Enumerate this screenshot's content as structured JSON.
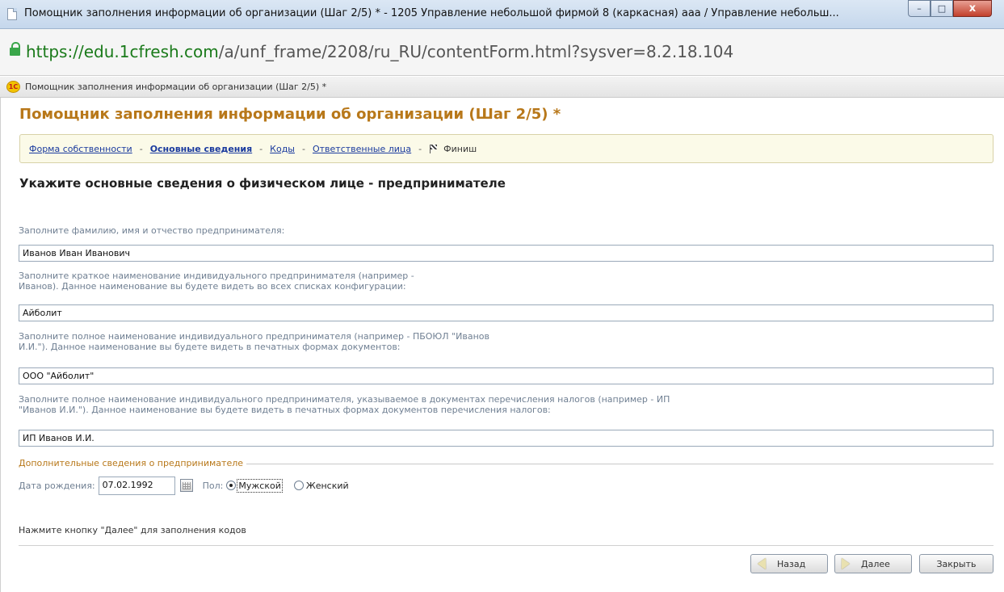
{
  "window": {
    "title": "Помощник заполнения информации об организации (Шаг 2/5) * - 1205 Управление небольшой фирмой 8 (каркасная) ааа / Управление небольш...",
    "min_glyph": "–",
    "max_glyph": "□",
    "close_glyph": "x"
  },
  "address": {
    "prefix": "https://",
    "host": "edu.1cfresh.com",
    "path": "/a/unf_frame/2208/ru_RU/contentForm.html?sysver=8.2.18.104"
  },
  "tab": {
    "logo_text": "1С",
    "title": "Помощник заполнения информации об организации (Шаг 2/5) *"
  },
  "form": {
    "title": "Помощник заполнения информации об организации (Шаг 2/5) *",
    "steps": [
      {
        "label": "Форма собственности"
      },
      {
        "label": "Основные сведения"
      },
      {
        "label": "Коды"
      },
      {
        "label": "Ответственные лица"
      },
      {
        "label": "Финиш"
      }
    ],
    "step_separator": "-",
    "section_title": "Укажите основные сведения о физическом лице - предпринимателе",
    "fields": [
      {
        "label_lines": [
          "Заполните фамилию, имя и отчество предпринимателя:"
        ],
        "value": "Иванов Иван Иванович"
      },
      {
        "label_lines": [
          "Заполните краткое наименование индивидуального предпринимателя (например -",
          "Иванов). Данное наименование вы будете видеть во всех списках конфигурации:"
        ],
        "value": "Айболит"
      },
      {
        "label_lines": [
          "Заполните полное наименование индивидуального предпринимателя (например - ПБОЮЛ \"Иванов",
          "И.И.\"). Данное наименование вы будете видеть в печатных формах документов:"
        ],
        "value": "ООО \"Айболит\""
      },
      {
        "label_lines": [
          "Заполните полное наименование индивидуального предпринимателя, указываемое в документах перечисления налогов (например - ИП",
          "\"Иванов И.И.\"). Данное наименование вы будете видеть в печатных формах документов перечисления налогов:"
        ],
        "value": "ИП Иванов И.И."
      }
    ],
    "extra": {
      "group_title": "Дополнительные сведения о предпринимателе",
      "birth_label": "Дата рождения:",
      "birth_value": "07.02.1992",
      "sex_label": "Пол:",
      "sex_male": "Мужской",
      "sex_female": "Женский",
      "sex_selected": "Мужской"
    },
    "hint": "Нажмите кнопку \"Далее\" для заполнения кодов",
    "buttons": {
      "back": "Назад",
      "next": "Далее",
      "close": "Закрыть"
    }
  }
}
